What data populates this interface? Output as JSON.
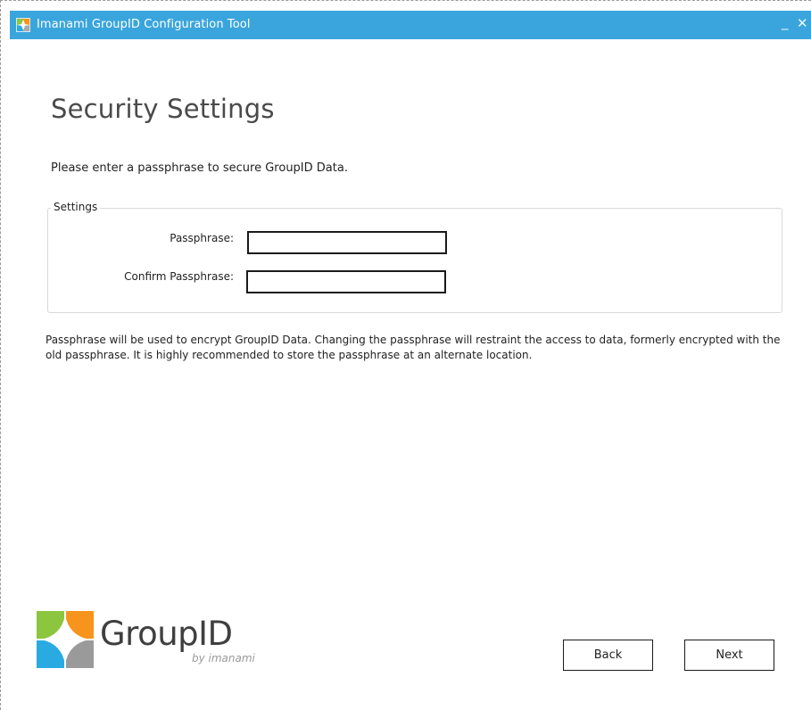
{
  "window": {
    "title": "Imanami GroupID Configuration Tool",
    "minimize_glyph": "_",
    "close_glyph": "✕",
    "titlebar_color": "#3aa5dc"
  },
  "page": {
    "title": "Security Settings",
    "intro": "Please enter a passphrase to secure GroupID Data."
  },
  "settings": {
    "legend": "Settings",
    "passphrase_label": "Passphrase:",
    "passphrase_value": "",
    "confirm_label": "Confirm Passphrase:",
    "confirm_value": ""
  },
  "note": "Passphrase will be used to encrypt GroupID Data. Changing the passphrase will restraint the access to data, formerly encrypted with the old passphrase. It is highly recommended to store the passphrase at an alternate location.",
  "branding": {
    "product": "GroupID",
    "by_line": "by imanami",
    "logo_icon": "groupid-logo-icon"
  },
  "buttons": {
    "back": "Back",
    "next": "Next"
  }
}
